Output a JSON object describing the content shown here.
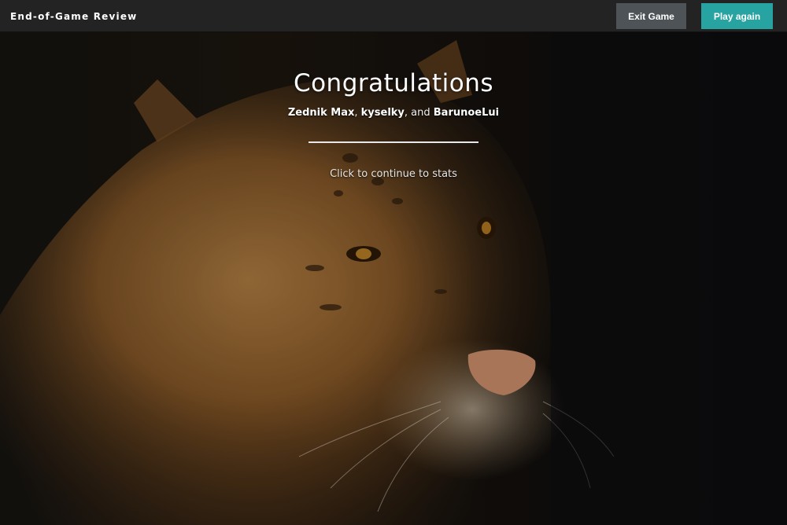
{
  "header": {
    "title": "End-of-Game Review",
    "exit_label": "Exit Game",
    "play_again_label": "Play again"
  },
  "main": {
    "heading": "Congratulations",
    "players": [
      "Zednik Max",
      "kyselky",
      "BarunoeLui"
    ],
    "players_sep1": ", ",
    "players_sep2": ", and ",
    "continue_text": "Click to continue to stats"
  },
  "colors": {
    "topbar_bg": "#232324",
    "exit_button_bg": "#4d5357",
    "play_button_bg": "#27a3a1"
  }
}
